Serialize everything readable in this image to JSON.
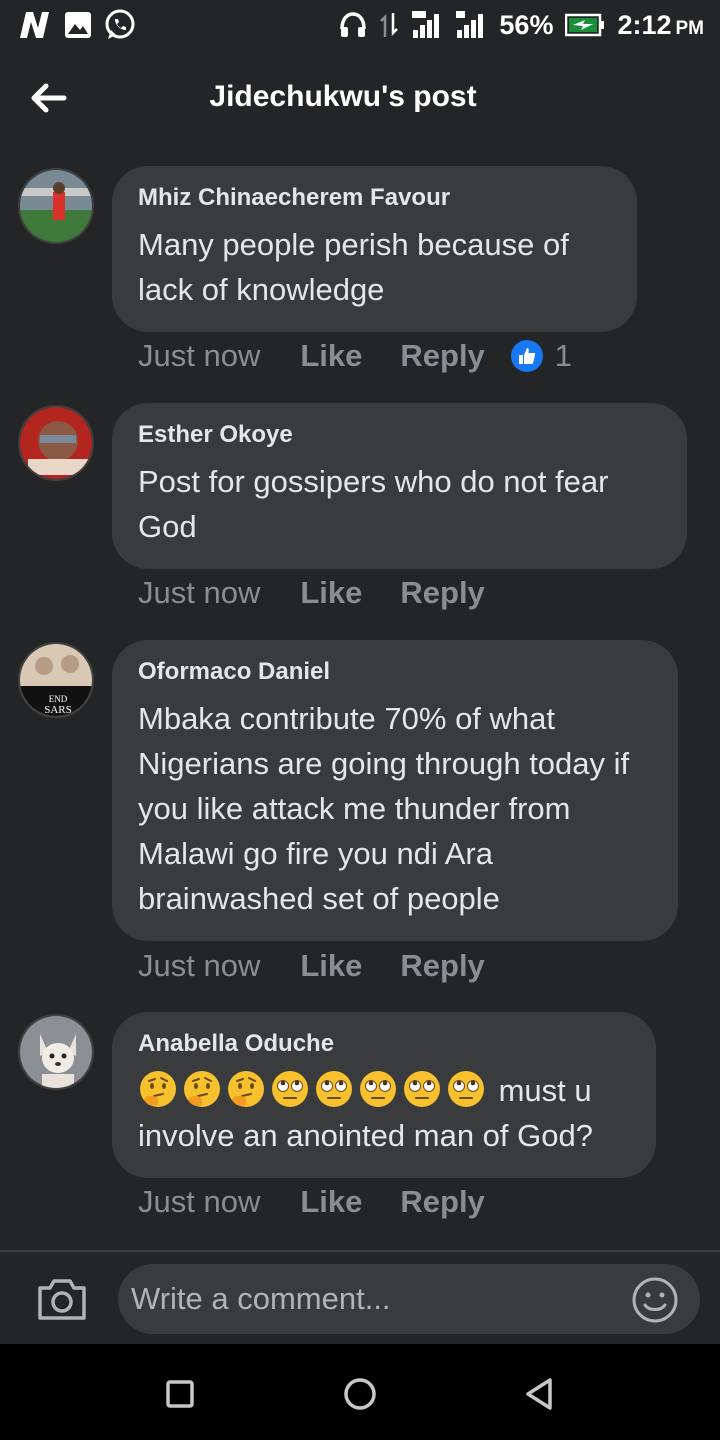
{
  "status_bar": {
    "battery": "56%",
    "time": "2:12",
    "ampm": "PM"
  },
  "header": {
    "title": "Jidechukwu's post"
  },
  "comments": [
    {
      "author": "Mhiz Chinaecherem Favour",
      "text": "Many people perish because of lack of knowledge",
      "time": "Just now",
      "like_label": "Like",
      "reply_label": "Reply",
      "reaction_count": "1"
    },
    {
      "author": "Esther Okoye",
      "text": "Post for gossipers who do not fear God",
      "time": "Just now",
      "like_label": "Like",
      "reply_label": "Reply"
    },
    {
      "author": "Oformaco Daniel",
      "text": "Mbaka contribute 70% of what Nigerians are going through today if you like attack me thunder from Malawi go fire you ndi Ara brainwashed set of people",
      "time": "Just now",
      "like_label": "Like",
      "reply_label": "Reply",
      "avatar_caption_line1": "END",
      "avatar_caption_line2": "SARS"
    },
    {
      "author": "Anabella Oduche",
      "text": "must u involve an anointed man of God?",
      "emojis": [
        "thinking-face",
        "thinking-face",
        "thinking-face",
        "face-with-rolling-eyes",
        "face-with-rolling-eyes",
        "face-with-rolling-eyes",
        "face-with-rolling-eyes",
        "face-with-rolling-eyes"
      ],
      "time": "Just now",
      "like_label": "Like",
      "reply_label": "Reply"
    }
  ],
  "composer": {
    "placeholder": "Write a comment..."
  },
  "colors": {
    "background": "#242526",
    "bubble": "#3a3b3c",
    "meta_text": "#8a8d91",
    "like_blue": "#1877f2"
  }
}
